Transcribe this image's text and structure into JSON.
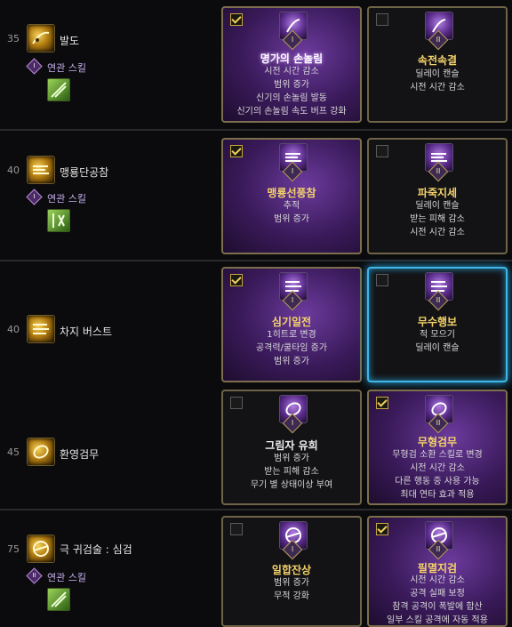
{
  "rows": [
    {
      "level": "35",
      "name": "발도",
      "related": {
        "badge": "I",
        "label": "연관 스킬"
      },
      "icon": "slash-arc-icon",
      "related_icon": "green-leaf-skill-icon",
      "options": [
        {
          "checked": true,
          "numeral": "I",
          "title": "명가의 손놀림",
          "lines": [
            "시전 시간 감소",
            "범위 증가",
            "신기의 손놀림 발동",
            "신기의 손놀림 속도 버프 강화"
          ]
        },
        {
          "checked": false,
          "numeral": "II",
          "title": "속전속결",
          "lines": [
            "딜레이 캔슬",
            "시전 시간 감소"
          ]
        }
      ]
    },
    {
      "level": "40",
      "name": "맹룡단공참",
      "related": {
        "badge": "I",
        "label": "연관 스킬"
      },
      "icon": "dragon-strike-icon",
      "related_icon": "green-rune-skill-icon",
      "options": [
        {
          "checked": true,
          "numeral": "I",
          "title": "맹룡선풍참",
          "lines": [
            "추적",
            "범위 증가"
          ]
        },
        {
          "checked": false,
          "numeral": "II",
          "title": "파죽지세",
          "lines": [
            "딜레이 캔슬",
            "받는 피해 감소",
            "시전 시간 감소"
          ]
        }
      ]
    },
    {
      "level": "40",
      "name": "차지 버스트",
      "icon": "charge-burst-icon",
      "options": [
        {
          "checked": true,
          "numeral": "I",
          "title": "심기일전",
          "lines": [
            "1히트로 변경",
            "공격력/쿨타임 증가",
            "범위 증가"
          ]
        },
        {
          "checked": false,
          "numeral": "II",
          "title": "무수행보",
          "lines": [
            "적 모으기",
            "딜레이 캔슬"
          ]
        }
      ]
    },
    {
      "level": "45",
      "name": "환영검무",
      "icon": "phantom-sword-dance-icon",
      "options": [
        {
          "checked": false,
          "numeral": "I",
          "title": "그림자 유희",
          "lines": [
            "범위 증가",
            "받는 피해 감소",
            "무기 별 상태이상 부여"
          ]
        },
        {
          "checked": true,
          "numeral": "II",
          "title": "무형검무",
          "lines": [
            "무형검 소환 스킬로 변경",
            "시전 시간 감소",
            "다른 행동 중 사용 가능",
            "최대 연타 효과 적용"
          ]
        }
      ]
    },
    {
      "level": "75",
      "name": "극 귀검술 : 심검",
      "related": {
        "badge": "II",
        "label": "연관 스킬"
      },
      "icon": "spirit-sword-icon",
      "related_icon": "green-leaf-skill-icon",
      "options": [
        {
          "checked": false,
          "numeral": "I",
          "title": "일합잔상",
          "lines": [
            "범위 증가",
            "무적 강화"
          ]
        },
        {
          "checked": true,
          "numeral": "II",
          "title": "필멸지검",
          "lines": [
            "시전 시간 감소",
            "공격 실패 보정",
            "참격 공격이 폭발에 합산",
            "일부 스킬 공격에 자동 적용"
          ]
        }
      ]
    }
  ],
  "colors": {
    "selected_bg": "#3a1a5a",
    "card_border": "#6f6447",
    "hover_border": "#3fb6e6",
    "title_gold": "#f4d36a",
    "related_text": "#c7b0f0"
  }
}
